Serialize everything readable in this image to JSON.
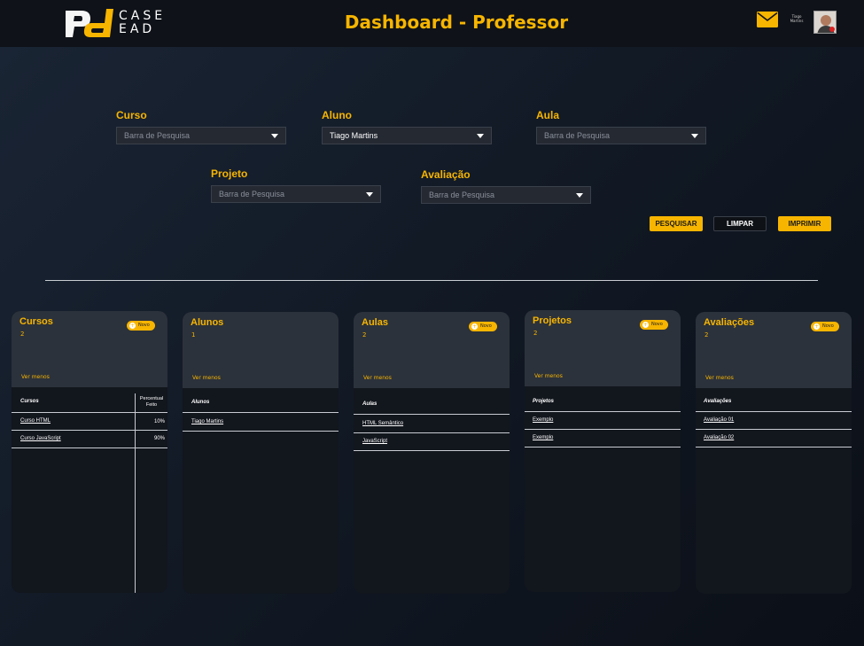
{
  "header": {
    "logo_text_line1": "CASE",
    "logo_text_line2": "EAD",
    "title": "Dashboard - Professor",
    "user_name_line1": "Tiago",
    "user_name_line2": "Martins",
    "mail_icon": "mail-icon",
    "accent": "#f7b500"
  },
  "filters": {
    "curso": {
      "label": "Curso",
      "value": "Barra de Pesquisa"
    },
    "aluno": {
      "label": "Aluno",
      "value": "Tiago Martins"
    },
    "aula": {
      "label": "Aula",
      "value": "Barra de Pesquisa"
    },
    "projeto": {
      "label": "Projeto",
      "value": "Barra de Pesquisa"
    },
    "avaliacao": {
      "label": "Avaliação",
      "value": "Barra de Pesquisa"
    }
  },
  "actions": {
    "pesquisar": "PESQUISAR",
    "limpar": "LIMPAR",
    "imprimir": "IMPRIMIR"
  },
  "cards": {
    "cursos": {
      "title": "Cursos",
      "count": "2",
      "less": "Ver menos",
      "novo": "Novo",
      "col1": "Cursos",
      "col2_line1": "Percentual",
      "col2_line2": "Feito",
      "rows": [
        {
          "name": "Curso HTML",
          "pct": "10%"
        },
        {
          "name": "Curso JavaScript",
          "pct": "90%"
        }
      ]
    },
    "alunos": {
      "title": "Alunos",
      "count": "1",
      "less": "Ver menos",
      "col1": "Alunos",
      "rows": [
        {
          "name": "Tiago Martins"
        }
      ]
    },
    "aulas": {
      "title": "Aulas",
      "count": "2",
      "less": "Ver menos",
      "novo": "Novo",
      "col1": "Aulas",
      "rows": [
        {
          "name": "HTML Semântico"
        },
        {
          "name": "JavaScript"
        }
      ]
    },
    "projetos": {
      "title": "Projetos",
      "count": "2",
      "less": "Ver menos",
      "novo": "Novo",
      "col1": "Projetos",
      "rows": [
        {
          "name": "Exemplo"
        },
        {
          "name": "Exemplo"
        }
      ]
    },
    "avaliacoes": {
      "title": "Avaliações",
      "count": "2",
      "less": "Ver menos",
      "novo": "Novo",
      "col1": "Avaliações",
      "rows": [
        {
          "name": "Avaliação 01"
        },
        {
          "name": "Avaliação 02"
        }
      ]
    }
  }
}
